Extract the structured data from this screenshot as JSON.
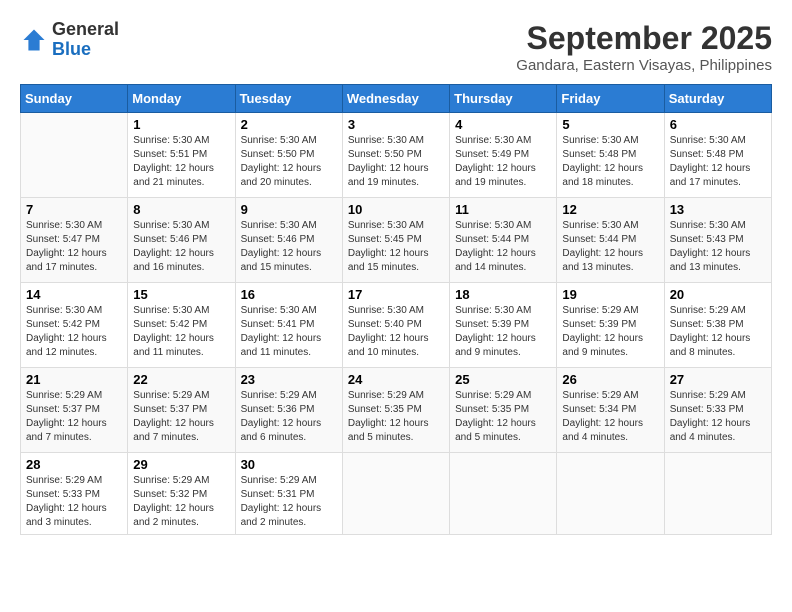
{
  "header": {
    "logo": {
      "general": "General",
      "blue": "Blue"
    },
    "title": "September 2025",
    "location": "Gandara, Eastern Visayas, Philippines"
  },
  "calendar": {
    "weekdays": [
      "Sunday",
      "Monday",
      "Tuesday",
      "Wednesday",
      "Thursday",
      "Friday",
      "Saturday"
    ],
    "weeks": [
      [
        {
          "day": "",
          "info": ""
        },
        {
          "day": "1",
          "info": "Sunrise: 5:30 AM\nSunset: 5:51 PM\nDaylight: 12 hours\nand 21 minutes."
        },
        {
          "day": "2",
          "info": "Sunrise: 5:30 AM\nSunset: 5:50 PM\nDaylight: 12 hours\nand 20 minutes."
        },
        {
          "day": "3",
          "info": "Sunrise: 5:30 AM\nSunset: 5:50 PM\nDaylight: 12 hours\nand 19 minutes."
        },
        {
          "day": "4",
          "info": "Sunrise: 5:30 AM\nSunset: 5:49 PM\nDaylight: 12 hours\nand 19 minutes."
        },
        {
          "day": "5",
          "info": "Sunrise: 5:30 AM\nSunset: 5:48 PM\nDaylight: 12 hours\nand 18 minutes."
        },
        {
          "day": "6",
          "info": "Sunrise: 5:30 AM\nSunset: 5:48 PM\nDaylight: 12 hours\nand 17 minutes."
        }
      ],
      [
        {
          "day": "7",
          "info": "Sunrise: 5:30 AM\nSunset: 5:47 PM\nDaylight: 12 hours\nand 17 minutes."
        },
        {
          "day": "8",
          "info": "Sunrise: 5:30 AM\nSunset: 5:46 PM\nDaylight: 12 hours\nand 16 minutes."
        },
        {
          "day": "9",
          "info": "Sunrise: 5:30 AM\nSunset: 5:46 PM\nDaylight: 12 hours\nand 15 minutes."
        },
        {
          "day": "10",
          "info": "Sunrise: 5:30 AM\nSunset: 5:45 PM\nDaylight: 12 hours\nand 15 minutes."
        },
        {
          "day": "11",
          "info": "Sunrise: 5:30 AM\nSunset: 5:44 PM\nDaylight: 12 hours\nand 14 minutes."
        },
        {
          "day": "12",
          "info": "Sunrise: 5:30 AM\nSunset: 5:44 PM\nDaylight: 12 hours\nand 13 minutes."
        },
        {
          "day": "13",
          "info": "Sunrise: 5:30 AM\nSunset: 5:43 PM\nDaylight: 12 hours\nand 13 minutes."
        }
      ],
      [
        {
          "day": "14",
          "info": "Sunrise: 5:30 AM\nSunset: 5:42 PM\nDaylight: 12 hours\nand 12 minutes."
        },
        {
          "day": "15",
          "info": "Sunrise: 5:30 AM\nSunset: 5:42 PM\nDaylight: 12 hours\nand 11 minutes."
        },
        {
          "day": "16",
          "info": "Sunrise: 5:30 AM\nSunset: 5:41 PM\nDaylight: 12 hours\nand 11 minutes."
        },
        {
          "day": "17",
          "info": "Sunrise: 5:30 AM\nSunset: 5:40 PM\nDaylight: 12 hours\nand 10 minutes."
        },
        {
          "day": "18",
          "info": "Sunrise: 5:30 AM\nSunset: 5:39 PM\nDaylight: 12 hours\nand 9 minutes."
        },
        {
          "day": "19",
          "info": "Sunrise: 5:29 AM\nSunset: 5:39 PM\nDaylight: 12 hours\nand 9 minutes."
        },
        {
          "day": "20",
          "info": "Sunrise: 5:29 AM\nSunset: 5:38 PM\nDaylight: 12 hours\nand 8 minutes."
        }
      ],
      [
        {
          "day": "21",
          "info": "Sunrise: 5:29 AM\nSunset: 5:37 PM\nDaylight: 12 hours\nand 7 minutes."
        },
        {
          "day": "22",
          "info": "Sunrise: 5:29 AM\nSunset: 5:37 PM\nDaylight: 12 hours\nand 7 minutes."
        },
        {
          "day": "23",
          "info": "Sunrise: 5:29 AM\nSunset: 5:36 PM\nDaylight: 12 hours\nand 6 minutes."
        },
        {
          "day": "24",
          "info": "Sunrise: 5:29 AM\nSunset: 5:35 PM\nDaylight: 12 hours\nand 5 minutes."
        },
        {
          "day": "25",
          "info": "Sunrise: 5:29 AM\nSunset: 5:35 PM\nDaylight: 12 hours\nand 5 minutes."
        },
        {
          "day": "26",
          "info": "Sunrise: 5:29 AM\nSunset: 5:34 PM\nDaylight: 12 hours\nand 4 minutes."
        },
        {
          "day": "27",
          "info": "Sunrise: 5:29 AM\nSunset: 5:33 PM\nDaylight: 12 hours\nand 4 minutes."
        }
      ],
      [
        {
          "day": "28",
          "info": "Sunrise: 5:29 AM\nSunset: 5:33 PM\nDaylight: 12 hours\nand 3 minutes."
        },
        {
          "day": "29",
          "info": "Sunrise: 5:29 AM\nSunset: 5:32 PM\nDaylight: 12 hours\nand 2 minutes."
        },
        {
          "day": "30",
          "info": "Sunrise: 5:29 AM\nSunset: 5:31 PM\nDaylight: 12 hours\nand 2 minutes."
        },
        {
          "day": "",
          "info": ""
        },
        {
          "day": "",
          "info": ""
        },
        {
          "day": "",
          "info": ""
        },
        {
          "day": "",
          "info": ""
        }
      ]
    ]
  }
}
